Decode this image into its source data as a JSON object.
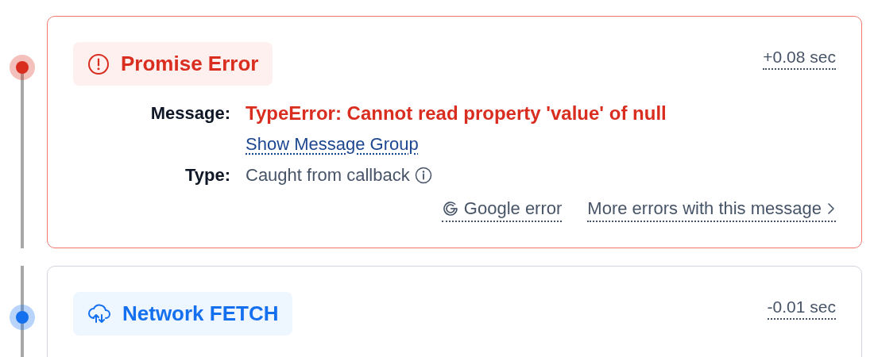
{
  "events": [
    {
      "kind": "error",
      "title": "Promise Error",
      "time": "+0.08 sec",
      "details": [
        {
          "label": "Message:",
          "value": "TypeError: Cannot read property 'value' of null",
          "kind": "error",
          "link": "Show Message Group"
        },
        {
          "label": "Type:",
          "value": "Caught from callback",
          "kind": "info"
        }
      ],
      "actions": [
        {
          "kind": "search",
          "label": "Google error"
        },
        {
          "kind": "more",
          "label": "More errors with this message"
        }
      ]
    },
    {
      "kind": "network",
      "title": "Network FETCH",
      "time": "-0.01 sec"
    }
  ]
}
